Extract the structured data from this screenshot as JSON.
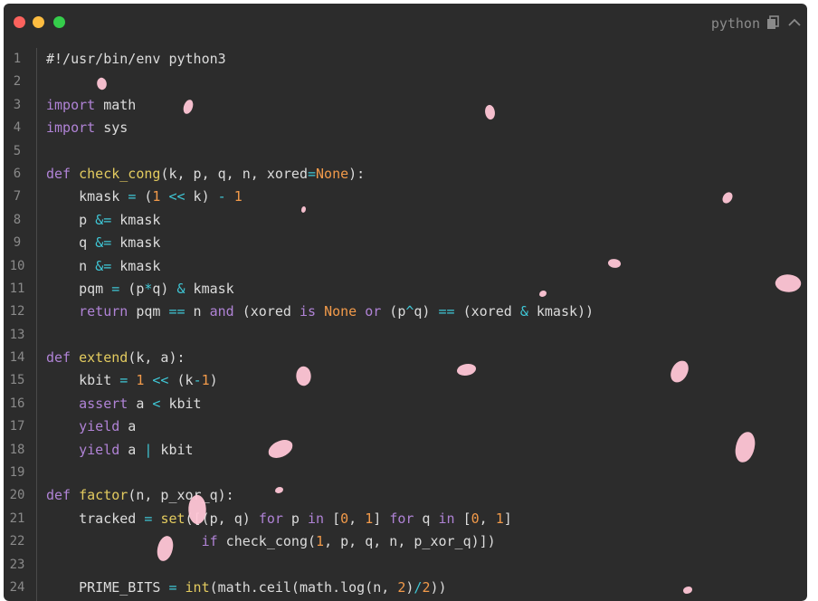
{
  "header": {
    "language": "python",
    "copy_icon": "copy-icon",
    "collapse_icon": "chevron-up-icon"
  },
  "colors": {
    "background": "#2c2c2c",
    "keyword": "#b083d6",
    "function": "#e3cb5f",
    "number": "#f29a4a",
    "operator": "#3fc7d6",
    "text": "#dcdcdc",
    "petal": "#ffc6d6"
  },
  "code_lines": [
    {
      "n": "1",
      "t": [
        [
          "c",
          "#!/usr/bin/env python3"
        ]
      ]
    },
    {
      "n": "2",
      "t": []
    },
    {
      "n": "3",
      "t": [
        [
          "kw",
          "import"
        ],
        [
          "p",
          " math"
        ]
      ]
    },
    {
      "n": "4",
      "t": [
        [
          "kw",
          "import"
        ],
        [
          "p",
          " sys"
        ]
      ]
    },
    {
      "n": "5",
      "t": []
    },
    {
      "n": "6",
      "t": [
        [
          "kw",
          "def"
        ],
        [
          "p",
          " "
        ],
        [
          "fn",
          "check_cong"
        ],
        [
          "p",
          "(k, p, q, n, xored"
        ],
        [
          "op",
          "="
        ],
        [
          "num",
          "None"
        ],
        [
          "p",
          "):"
        ]
      ]
    },
    {
      "n": "7",
      "t": [
        [
          "p",
          "    kmask "
        ],
        [
          "op",
          "="
        ],
        [
          "p",
          " ("
        ],
        [
          "num",
          "1"
        ],
        [
          "p",
          " "
        ],
        [
          "op",
          "<<"
        ],
        [
          "p",
          " k) "
        ],
        [
          "op",
          "-"
        ],
        [
          "p",
          " "
        ],
        [
          "num",
          "1"
        ]
      ]
    },
    {
      "n": "8",
      "t": [
        [
          "p",
          "    p "
        ],
        [
          "op",
          "&="
        ],
        [
          "p",
          " kmask"
        ]
      ]
    },
    {
      "n": "9",
      "t": [
        [
          "p",
          "    q "
        ],
        [
          "op",
          "&="
        ],
        [
          "p",
          " kmask"
        ]
      ]
    },
    {
      "n": "10",
      "t": [
        [
          "p",
          "    n "
        ],
        [
          "op",
          "&="
        ],
        [
          "p",
          " kmask"
        ]
      ]
    },
    {
      "n": "11",
      "t": [
        [
          "p",
          "    pqm "
        ],
        [
          "op",
          "="
        ],
        [
          "p",
          " (p"
        ],
        [
          "op",
          "*"
        ],
        [
          "p",
          "q) "
        ],
        [
          "op",
          "&"
        ],
        [
          "p",
          " kmask"
        ]
      ]
    },
    {
      "n": "12",
      "t": [
        [
          "kw",
          "    return"
        ],
        [
          "p",
          " pqm "
        ],
        [
          "op",
          "=="
        ],
        [
          "p",
          " n "
        ],
        [
          "kw",
          "and"
        ],
        [
          "p",
          " (xored "
        ],
        [
          "kw",
          "is"
        ],
        [
          "p",
          " "
        ],
        [
          "num",
          "None"
        ],
        [
          "p",
          " "
        ],
        [
          "kw",
          "or"
        ],
        [
          "p",
          " (p"
        ],
        [
          "op",
          "^"
        ],
        [
          "p",
          "q) "
        ],
        [
          "op",
          "=="
        ],
        [
          "p",
          " (xored "
        ],
        [
          "op",
          "&"
        ],
        [
          "p",
          " kmask))"
        ]
      ]
    },
    {
      "n": "13",
      "t": []
    },
    {
      "n": "14",
      "t": [
        [
          "kw",
          "def"
        ],
        [
          "p",
          " "
        ],
        [
          "fn",
          "extend"
        ],
        [
          "p",
          "(k, a):"
        ]
      ]
    },
    {
      "n": "15",
      "t": [
        [
          "p",
          "    kbit "
        ],
        [
          "op",
          "="
        ],
        [
          "p",
          " "
        ],
        [
          "num",
          "1"
        ],
        [
          "p",
          " "
        ],
        [
          "op",
          "<<"
        ],
        [
          "p",
          " (k"
        ],
        [
          "op",
          "-"
        ],
        [
          "num",
          "1"
        ],
        [
          "p",
          ")"
        ]
      ]
    },
    {
      "n": "16",
      "t": [
        [
          "kw",
          "    assert"
        ],
        [
          "p",
          " a "
        ],
        [
          "op",
          "<"
        ],
        [
          "p",
          " kbit"
        ]
      ]
    },
    {
      "n": "17",
      "t": [
        [
          "kw",
          "    yield"
        ],
        [
          "p",
          " a"
        ]
      ]
    },
    {
      "n": "18",
      "t": [
        [
          "kw",
          "    yield"
        ],
        [
          "p",
          " a "
        ],
        [
          "op",
          "|"
        ],
        [
          "p",
          " kbit"
        ]
      ]
    },
    {
      "n": "19",
      "t": []
    },
    {
      "n": "20",
      "t": [
        [
          "kw",
          "def"
        ],
        [
          "p",
          " "
        ],
        [
          "fn",
          "factor"
        ],
        [
          "p",
          "(n, p_xor_q):"
        ]
      ]
    },
    {
      "n": "21",
      "t": [
        [
          "p",
          "    tracked "
        ],
        [
          "op",
          "="
        ],
        [
          "p",
          " "
        ],
        [
          "fn",
          "set"
        ],
        [
          "p",
          "([(p, q) "
        ],
        [
          "kw",
          "for"
        ],
        [
          "p",
          " p "
        ],
        [
          "kw",
          "in"
        ],
        [
          "p",
          " ["
        ],
        [
          "num",
          "0"
        ],
        [
          "p",
          ", "
        ],
        [
          "num",
          "1"
        ],
        [
          "p",
          "] "
        ],
        [
          "kw",
          "for"
        ],
        [
          "p",
          " q "
        ],
        [
          "kw",
          "in"
        ],
        [
          "p",
          " ["
        ],
        [
          "num",
          "0"
        ],
        [
          "p",
          ", "
        ],
        [
          "num",
          "1"
        ],
        [
          "p",
          "]"
        ]
      ]
    },
    {
      "n": "22",
      "t": [
        [
          "p",
          "                   "
        ],
        [
          "kw",
          "if"
        ],
        [
          "p",
          " check_cong("
        ],
        [
          "num",
          "1"
        ],
        [
          "p",
          ", p, q, n, p_xor_q)])"
        ]
      ]
    },
    {
      "n": "23",
      "t": []
    },
    {
      "n": "24",
      "t": [
        [
          "p",
          "    PRIME_BITS "
        ],
        [
          "op",
          "="
        ],
        [
          "p",
          " "
        ],
        [
          "fn",
          "int"
        ],
        [
          "p",
          "(math.ceil(math.log(n, "
        ],
        [
          "num",
          "2"
        ],
        [
          "p",
          ")"
        ],
        [
          "op",
          "/"
        ],
        [
          "num",
          "2"
        ],
        [
          "p",
          "))"
        ]
      ]
    }
  ]
}
